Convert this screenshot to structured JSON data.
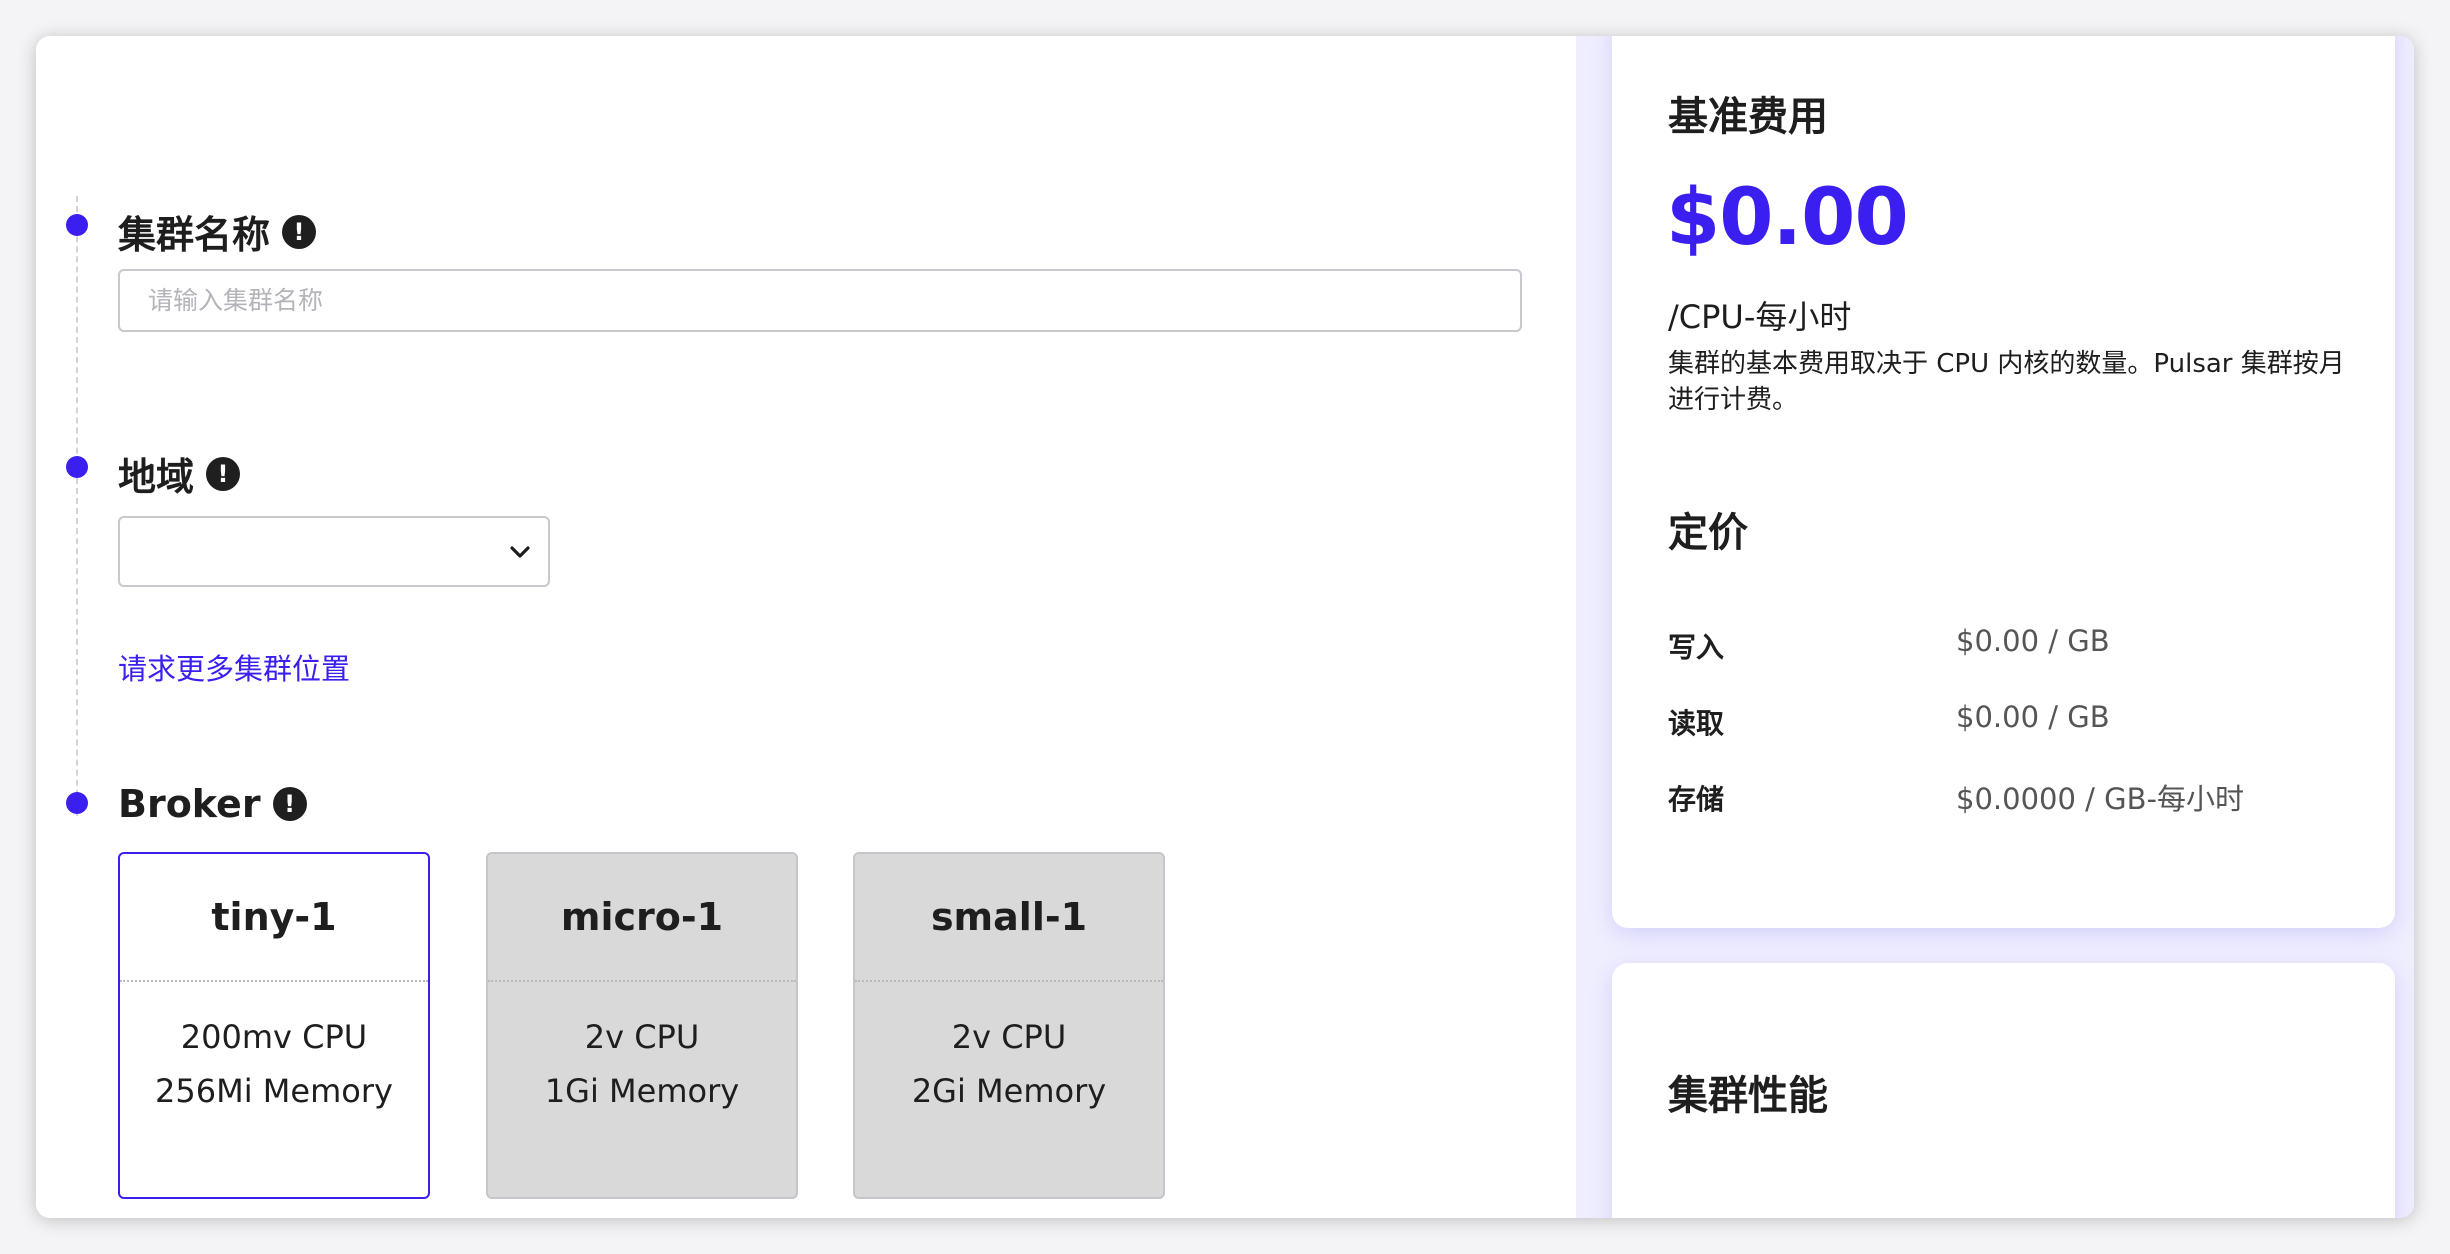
{
  "form": {
    "cluster_name": {
      "title": "集群名称",
      "placeholder": "请输入集群名称",
      "value": ""
    },
    "region": {
      "title": "地域",
      "selected": "",
      "more_link": "请求更多集群位置"
    },
    "broker": {
      "title": "Broker",
      "options": [
        {
          "name": "tiny-1",
          "cpu": "200mv CPU",
          "memory": "256Mi Memory",
          "selected": true
        },
        {
          "name": "micro-1",
          "cpu": "2v CPU",
          "memory": "1Gi Memory",
          "selected": false
        },
        {
          "name": "small-1",
          "cpu": "2v CPU",
          "memory": "2Gi Memory",
          "selected": false
        }
      ]
    }
  },
  "summary": {
    "base_fee": {
      "title": "基准费用",
      "price": "$0.00",
      "unit": "/CPU-每小时",
      "description": "集群的基本费用取决于 CPU 内核的数量。Pulsar 集群按月进行计费。"
    },
    "pricing": {
      "title": "定价",
      "rows": [
        {
          "label": "写入",
          "value": "$0.00 / GB"
        },
        {
          "label": "读取",
          "value": "$0.00 / GB"
        },
        {
          "label": "存储",
          "value": "$0.0000 / GB-每小时"
        }
      ]
    },
    "performance": {
      "title": "集群性能"
    }
  },
  "colors": {
    "accent": "#3a1ff0",
    "card_disabled": "#d9d9d9",
    "panel_bg": "#efeefe"
  }
}
